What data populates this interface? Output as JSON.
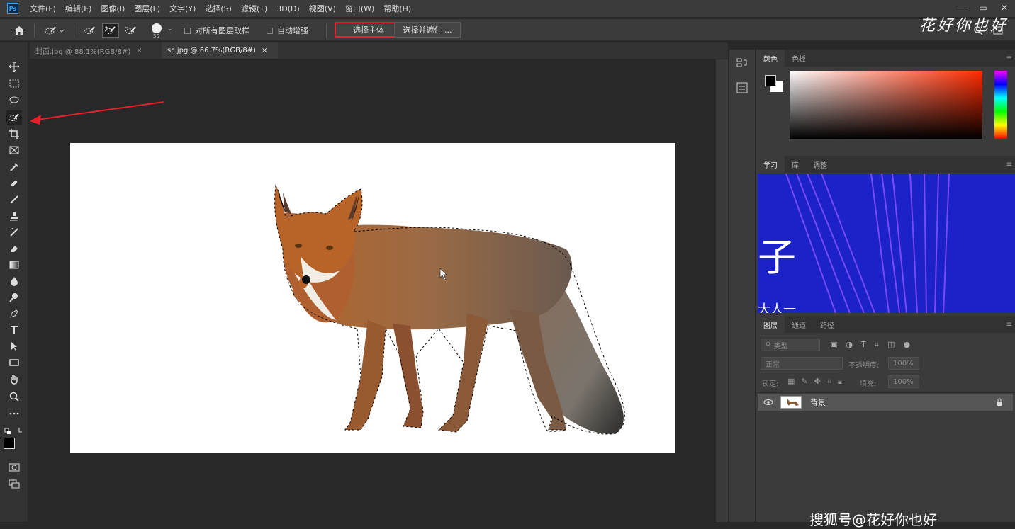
{
  "app": {
    "logo": "Ps"
  },
  "menu": [
    "文件(F)",
    "编辑(E)",
    "图像(I)",
    "图层(L)",
    "文字(Y)",
    "选择(S)",
    "滤镜(T)",
    "3D(D)",
    "视图(V)",
    "窗口(W)",
    "帮助(H)"
  ],
  "window_controls": [
    "—",
    "▭",
    "✕"
  ],
  "options": {
    "brush_size": "30",
    "sample_all_layers": "对所有图层取样",
    "auto_enhance": "自动增强",
    "select_subject": "选择主体",
    "select_and_mask": "选择并遮住 ..."
  },
  "tabs": [
    {
      "label": "封面.jpg @ 88.1%(RGB/8#)",
      "close": "×"
    },
    {
      "label": "sc.jpg @ 66.7%(RGB/8#)",
      "close": "×"
    }
  ],
  "panels": {
    "color_tabs": [
      "颜色",
      "色板"
    ],
    "learn_tabs": [
      "学习",
      "库",
      "调整"
    ],
    "learn_banner_text": "子",
    "learn_banner_sub": "大人一",
    "layers_tabs": [
      "图层",
      "通道",
      "路径"
    ],
    "layer_filter_placeholder": "类型",
    "blend_mode": "正常",
    "opacity_label": "不透明度:",
    "opacity_value": "100%",
    "lock_label": "锁定:",
    "fill_label": "填充:",
    "fill_value": "100%",
    "layers": [
      {
        "name": "背景"
      }
    ]
  },
  "watermark": "花好你也好",
  "bottom_text": "搜狐号@花好你也好",
  "colors": {
    "accent_red": "#e8202a",
    "learn_banner": "#1a22c8",
    "menubar": "#3b3b3b",
    "panel": "#3b3b3b"
  },
  "icons": [
    "home-icon",
    "quick-selection-icon",
    "brush-icon",
    "lock-icon",
    "eye-icon",
    "search-icon"
  ]
}
